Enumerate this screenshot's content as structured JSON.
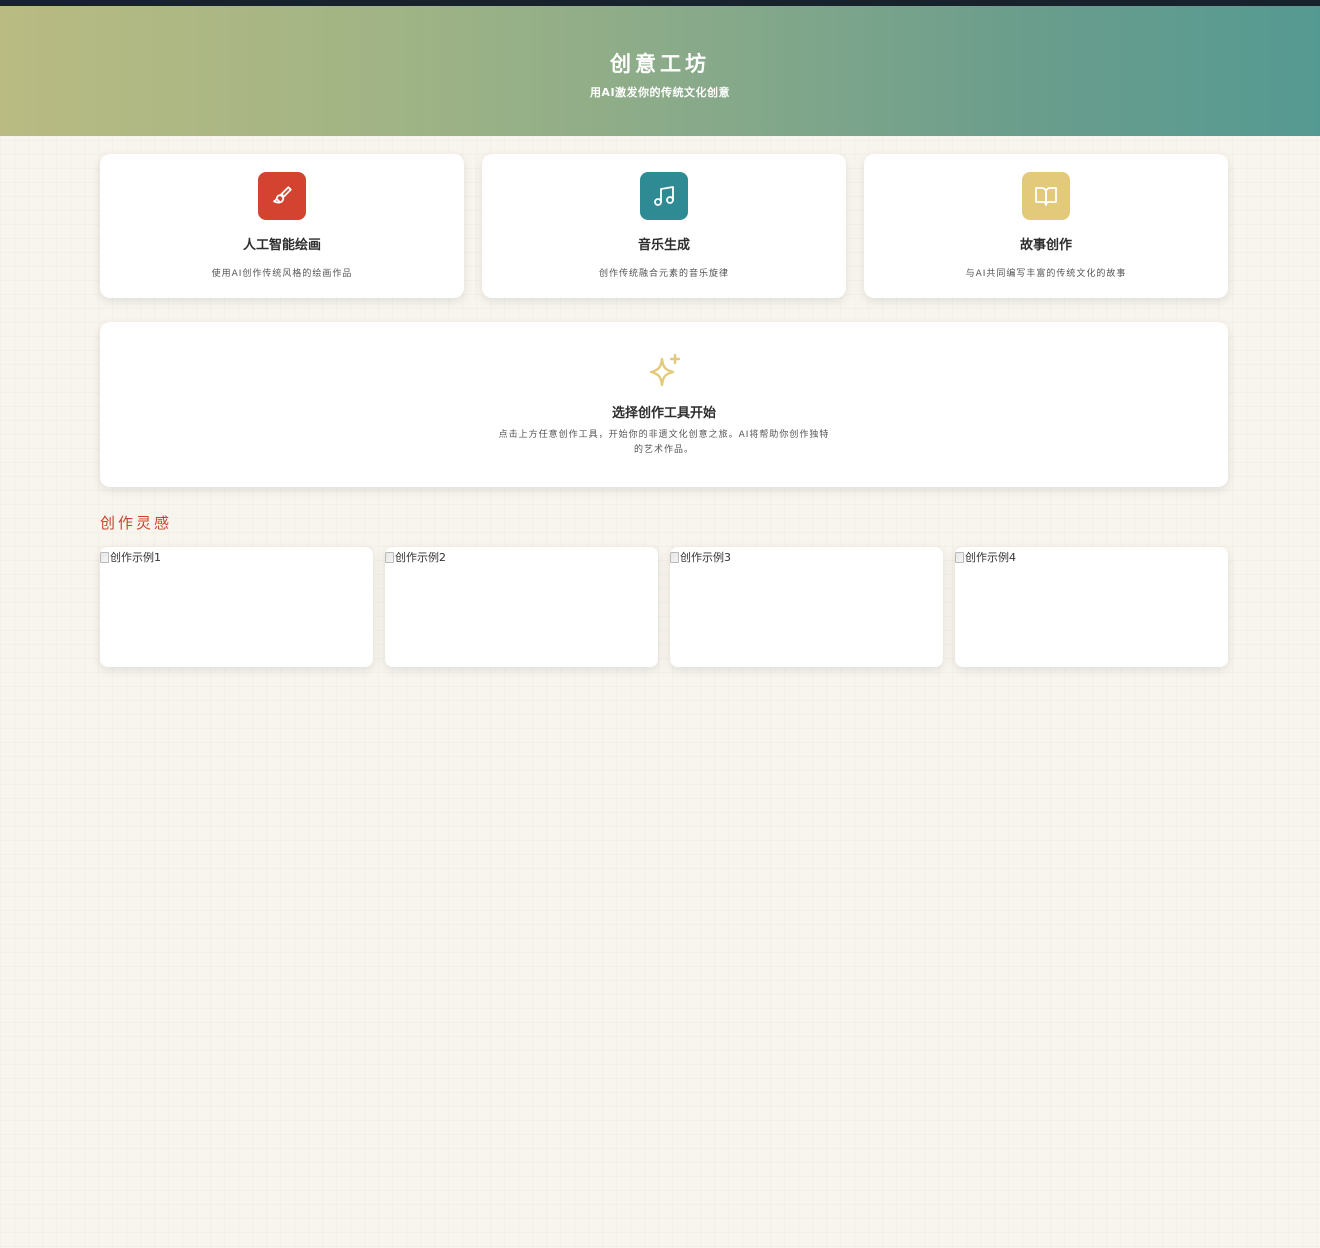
{
  "header": {
    "title": "创意工坊",
    "subtitle": "用AI激发你的传统文化创意"
  },
  "tools": [
    {
      "title": "人工智能绘画",
      "description": "使用AI创作传统风格的绘画作品",
      "icon": "paintbrush-icon",
      "color": "#d4432f"
    },
    {
      "title": "音乐生成",
      "description": "创作传统融合元素的音乐旋律",
      "icon": "music-note-icon",
      "color": "#2e8b93"
    },
    {
      "title": "故事创作",
      "description": "与AI共同编写丰富的传统文化的故事",
      "icon": "open-book-icon",
      "color": "#e3c97a"
    }
  ],
  "start_panel": {
    "title": "选择创作工具开始",
    "description": "点击上方任意创作工具，开始你的非遗文化创意之旅。AI将帮助你创作独特的艺术作品。",
    "icon": "sparkle-icon",
    "icon_color": "#e3c97a"
  },
  "inspiration": {
    "title": "创作灵感",
    "title_color": "#c8442c",
    "examples": [
      {
        "alt": "创作示例1"
      },
      {
        "alt": "创作示例2"
      },
      {
        "alt": "创作示例3"
      },
      {
        "alt": "创作示例4"
      }
    ]
  }
}
